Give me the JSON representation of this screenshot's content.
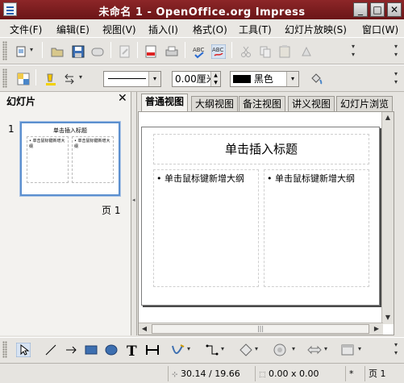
{
  "window": {
    "title": "未命名 1 - OpenOffice.org Impress",
    "minimize": "_",
    "maximize": "□",
    "close": "✕"
  },
  "menu": [
    "文件(F)",
    "编辑(E)",
    "视图(V)",
    "插入(I)",
    "格式(O)",
    "工具(T)",
    "幻灯片放映(S)",
    "窗口(W)"
  ],
  "formatting": {
    "line_width": "0.00厘米",
    "color_name": "黑色",
    "color_swatch": "#000000"
  },
  "slide_pane": {
    "title": "幻灯片",
    "close": "✕",
    "slide_number": "1",
    "slide_label": "页 1",
    "thumb_title": "单击插入标题",
    "thumb_bullet": "• 单击鼠标键新增大纲"
  },
  "tabs": [
    "普通视图",
    "大纲视图",
    "备注视图",
    "讲义视图",
    "幻灯片浏览"
  ],
  "slide": {
    "title_placeholder": "单击插入标题",
    "left_placeholder": "• 单击鼠标键新增大纲",
    "right_placeholder": "• 单击鼠标键新增大纲"
  },
  "status": {
    "position": "30.14 / 19.66",
    "size": "0.00 x 0.00",
    "modified": "*",
    "page": "页 1"
  },
  "colors": {
    "titlebar": "#7a1c1e",
    "selection": "#5b8fcf"
  }
}
